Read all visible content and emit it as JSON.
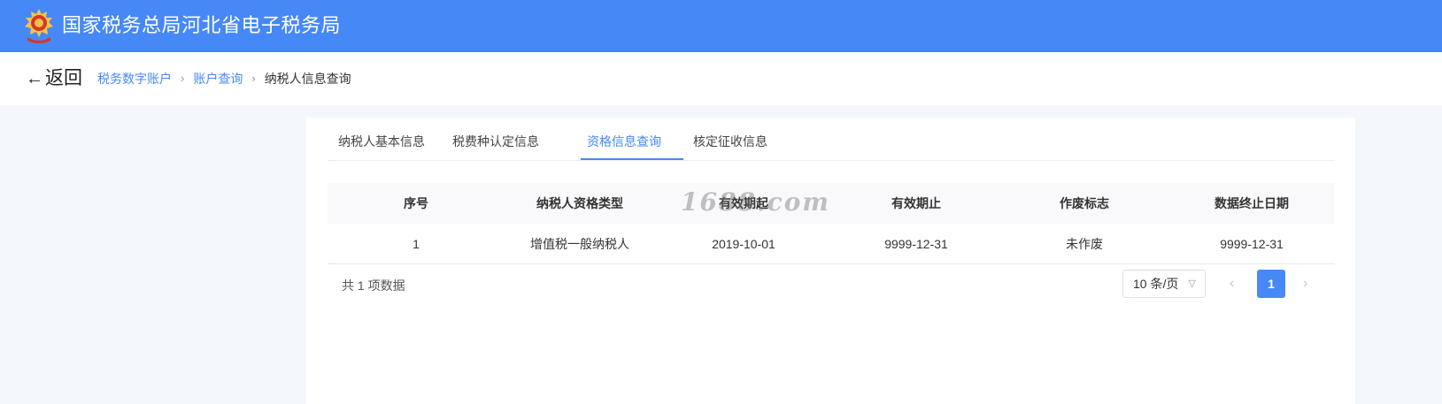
{
  "header": {
    "title": "国家税务总局河北省电子税务局",
    "emblem_icon": "tax-emblem-icon",
    "bg_color": "#4788f7"
  },
  "nav": {
    "back_label": "返回",
    "back_icon": "arrow-left-icon",
    "breadcrumb": [
      "税务数字账户",
      "账户查询",
      "纳税人信息查询"
    ]
  },
  "tabs": [
    {
      "label": "纳税人基本信息",
      "active": false
    },
    {
      "label": "税费种认定信息",
      "active": false
    },
    {
      "label": "资格信息查询",
      "active": true
    },
    {
      "label": "核定征收信息",
      "active": false
    }
  ],
  "table": {
    "columns": [
      "序号",
      "纳税人资格类型",
      "有效期起",
      "有效期止",
      "作废标志",
      "数据终止日期"
    ],
    "rows": [
      [
        "1",
        "增值税一般纳税人",
        "2019-10-01",
        "9999-12-31",
        "未作废",
        "9999-12-31"
      ]
    ]
  },
  "watermark": "1688.com",
  "pagination": {
    "total_text": "共 1 项数据",
    "page_size_label": "10 条/页",
    "current_page": "1",
    "prev_icon": "chevron-left-icon",
    "next_icon": "chevron-right-icon"
  },
  "colors": {
    "accent": "#4788f7",
    "page_bg": "#f4f7fb"
  }
}
